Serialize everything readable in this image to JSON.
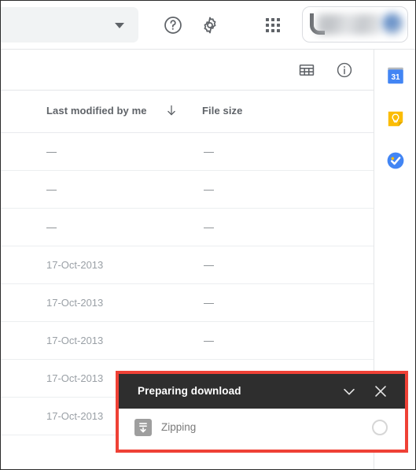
{
  "topbar": {
    "search": {
      "value": "",
      "placeholder": "",
      "caret_icon": "dropdown-caret-icon"
    },
    "help_icon": "help-circle-icon",
    "settings_icon": "gear-icon",
    "apps_icon": "apps-grid-icon",
    "account": {
      "name_redacted": "",
      "avatar_redacted": ""
    }
  },
  "toolbar": {
    "gridview_icon": "grid-view-icon",
    "info_icon": "info-circle-icon"
  },
  "filelist": {
    "columns": [
      {
        "label": "Last modified by me",
        "sort_icon": "arrow-down-icon",
        "sorted": true
      },
      {
        "label": "File size",
        "sort_icon": null,
        "sorted": false
      }
    ],
    "rows": [
      {
        "modified": "—",
        "size": "—"
      },
      {
        "modified": "—",
        "size": "—"
      },
      {
        "modified": "—",
        "size": "—"
      },
      {
        "modified": "17-Oct-2013",
        "size": "—"
      },
      {
        "modified": "17-Oct-2013",
        "size": "—"
      },
      {
        "modified": "17-Oct-2013",
        "size": "—"
      },
      {
        "modified": "17-Oct-2013",
        "size": "—"
      },
      {
        "modified": "17-Oct-2013",
        "size": "—"
      }
    ]
  },
  "sidepanel": {
    "items": [
      {
        "name": "calendar",
        "icon": "google-calendar-icon",
        "day_label": "31",
        "color": "#4285f4"
      },
      {
        "name": "keep",
        "icon": "google-keep-icon",
        "color": "#fbbc04"
      },
      {
        "name": "tasks",
        "icon": "google-tasks-icon",
        "color": "#4285f4"
      }
    ]
  },
  "download_dialog": {
    "title": "Preparing download",
    "collapse_icon": "chevron-down-icon",
    "close_icon": "close-icon",
    "item": {
      "file_icon": "zip-file-icon",
      "status": "Zipping",
      "progress_icon": "spinner-icon"
    },
    "highlight_color": "#ef4136",
    "header_color": "#2e2e2e"
  }
}
